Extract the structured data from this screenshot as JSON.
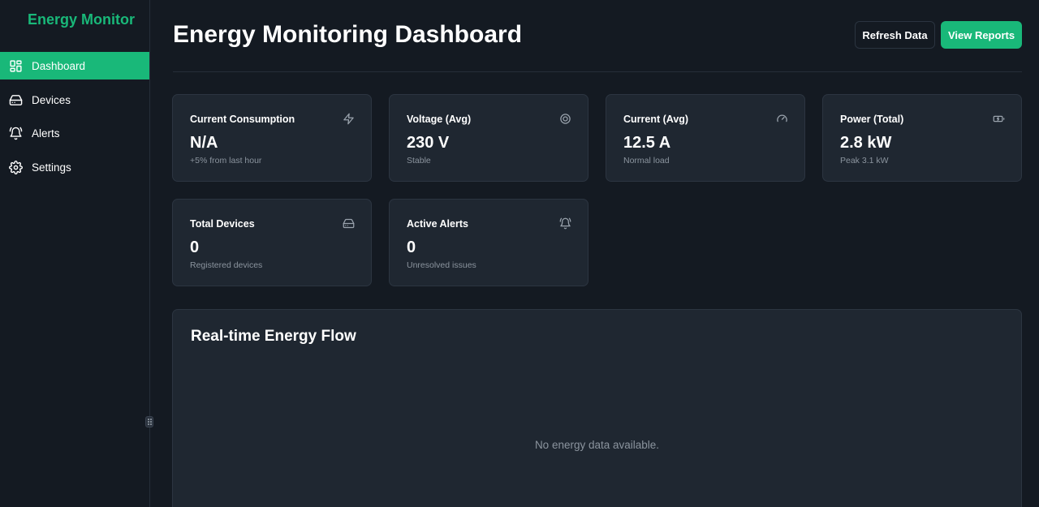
{
  "app": {
    "brand": "Energy Monitor"
  },
  "sidebar": {
    "items": [
      {
        "label": "Dashboard",
        "icon": "dashboard-icon",
        "active": true
      },
      {
        "label": "Devices",
        "icon": "devices-icon",
        "active": false
      },
      {
        "label": "Alerts",
        "icon": "bell-icon",
        "active": false
      },
      {
        "label": "Settings",
        "icon": "gear-icon",
        "active": false
      }
    ]
  },
  "header": {
    "title": "Energy Monitoring Dashboard",
    "refresh_label": "Refresh Data",
    "reports_label": "View Reports"
  },
  "cards": [
    {
      "title": "Current Consumption",
      "value": "N/A",
      "sub": "+5% from last hour",
      "icon": "lightning-icon"
    },
    {
      "title": "Voltage (Avg)",
      "value": "230 V",
      "sub": "Stable",
      "icon": "target-icon"
    },
    {
      "title": "Current (Avg)",
      "value": "12.5 A",
      "sub": "Normal load",
      "icon": "gauge-icon"
    },
    {
      "title": "Power (Total)",
      "value": "2.8 kW",
      "sub": "Peak 3.1 kW",
      "icon": "battery-icon"
    },
    {
      "title": "Total Devices",
      "value": "0",
      "sub": "Registered devices",
      "icon": "devices-icon"
    },
    {
      "title": "Active Alerts",
      "value": "0",
      "sub": "Unresolved issues",
      "icon": "bell-icon"
    }
  ],
  "energy_flow": {
    "title": "Real-time Energy Flow",
    "empty_text": "No energy data available."
  },
  "colors": {
    "accent": "#19b879",
    "background": "#141a22",
    "card": "#1f2731",
    "muted_text": "#8b949e"
  }
}
